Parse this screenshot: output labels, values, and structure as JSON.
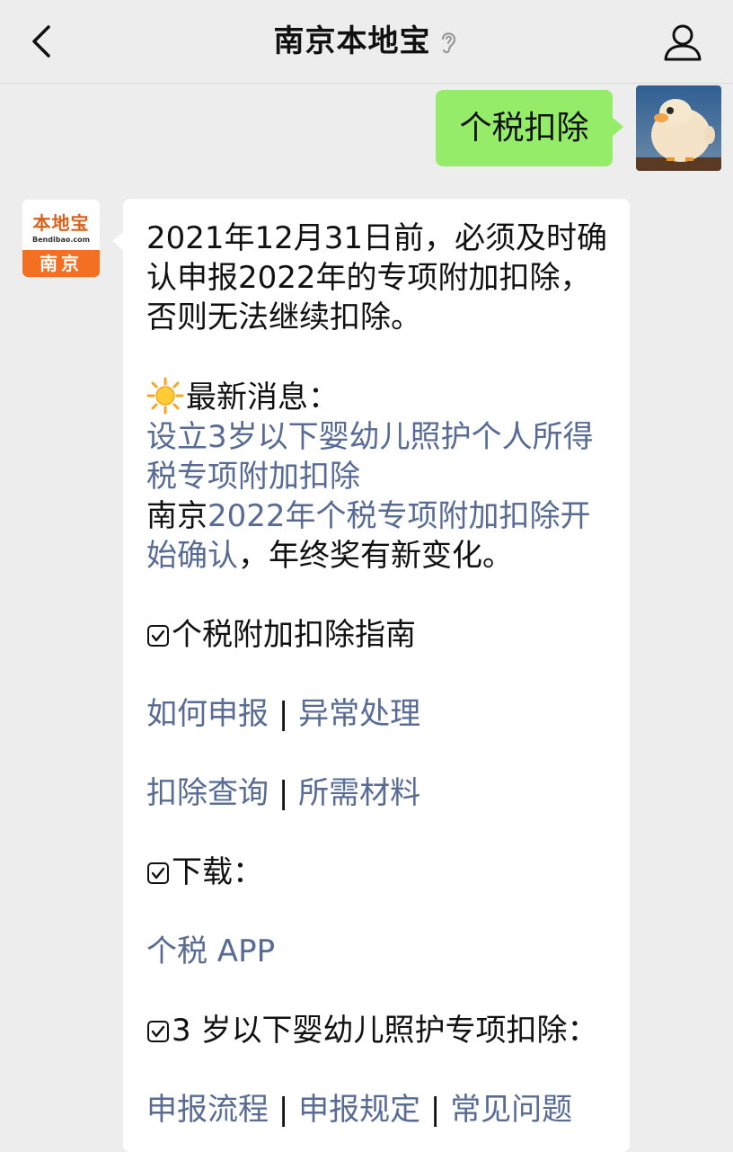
{
  "header": {
    "title": "南京本地宝",
    "back_icon": "chevron-left-icon",
    "ear_icon": "ear-icon",
    "user_icon": "user-icon"
  },
  "outgoing": {
    "text": "个税扣除"
  },
  "sender": {
    "logo_cn": "本地宝",
    "logo_en": "Bendibao.com",
    "logo_city": "南京"
  },
  "message": {
    "intro": "2021年12月31日前，必须及时确认申报2022年的专项附加扣除，否则无法继续扣除。",
    "news_title": "最新消息：",
    "news_link1": "设立3岁以下婴幼儿照护个人所得税专项附加扣除",
    "news_line2_prefix": "南京",
    "news_link2": "2022年个税专项附加扣除开始确认",
    "news_line2_suffix": "，年终奖有新变化。",
    "guide_title": "个税附加扣除指南",
    "guide_links_row1": [
      "如何申报",
      "异常处理"
    ],
    "guide_links_row2": [
      "扣除查询",
      "所需材料"
    ],
    "separator": "|",
    "download_title": "下载：",
    "download_link": "个税 APP",
    "infant_title": "3 岁以下婴幼儿照护专项扣除：",
    "infant_links": [
      "申报流程",
      "申报规定",
      "常见问题"
    ]
  },
  "colors": {
    "link": "#576b95",
    "outgoing_bubble": "#95ec69",
    "logo_orange": "#f36f21"
  }
}
